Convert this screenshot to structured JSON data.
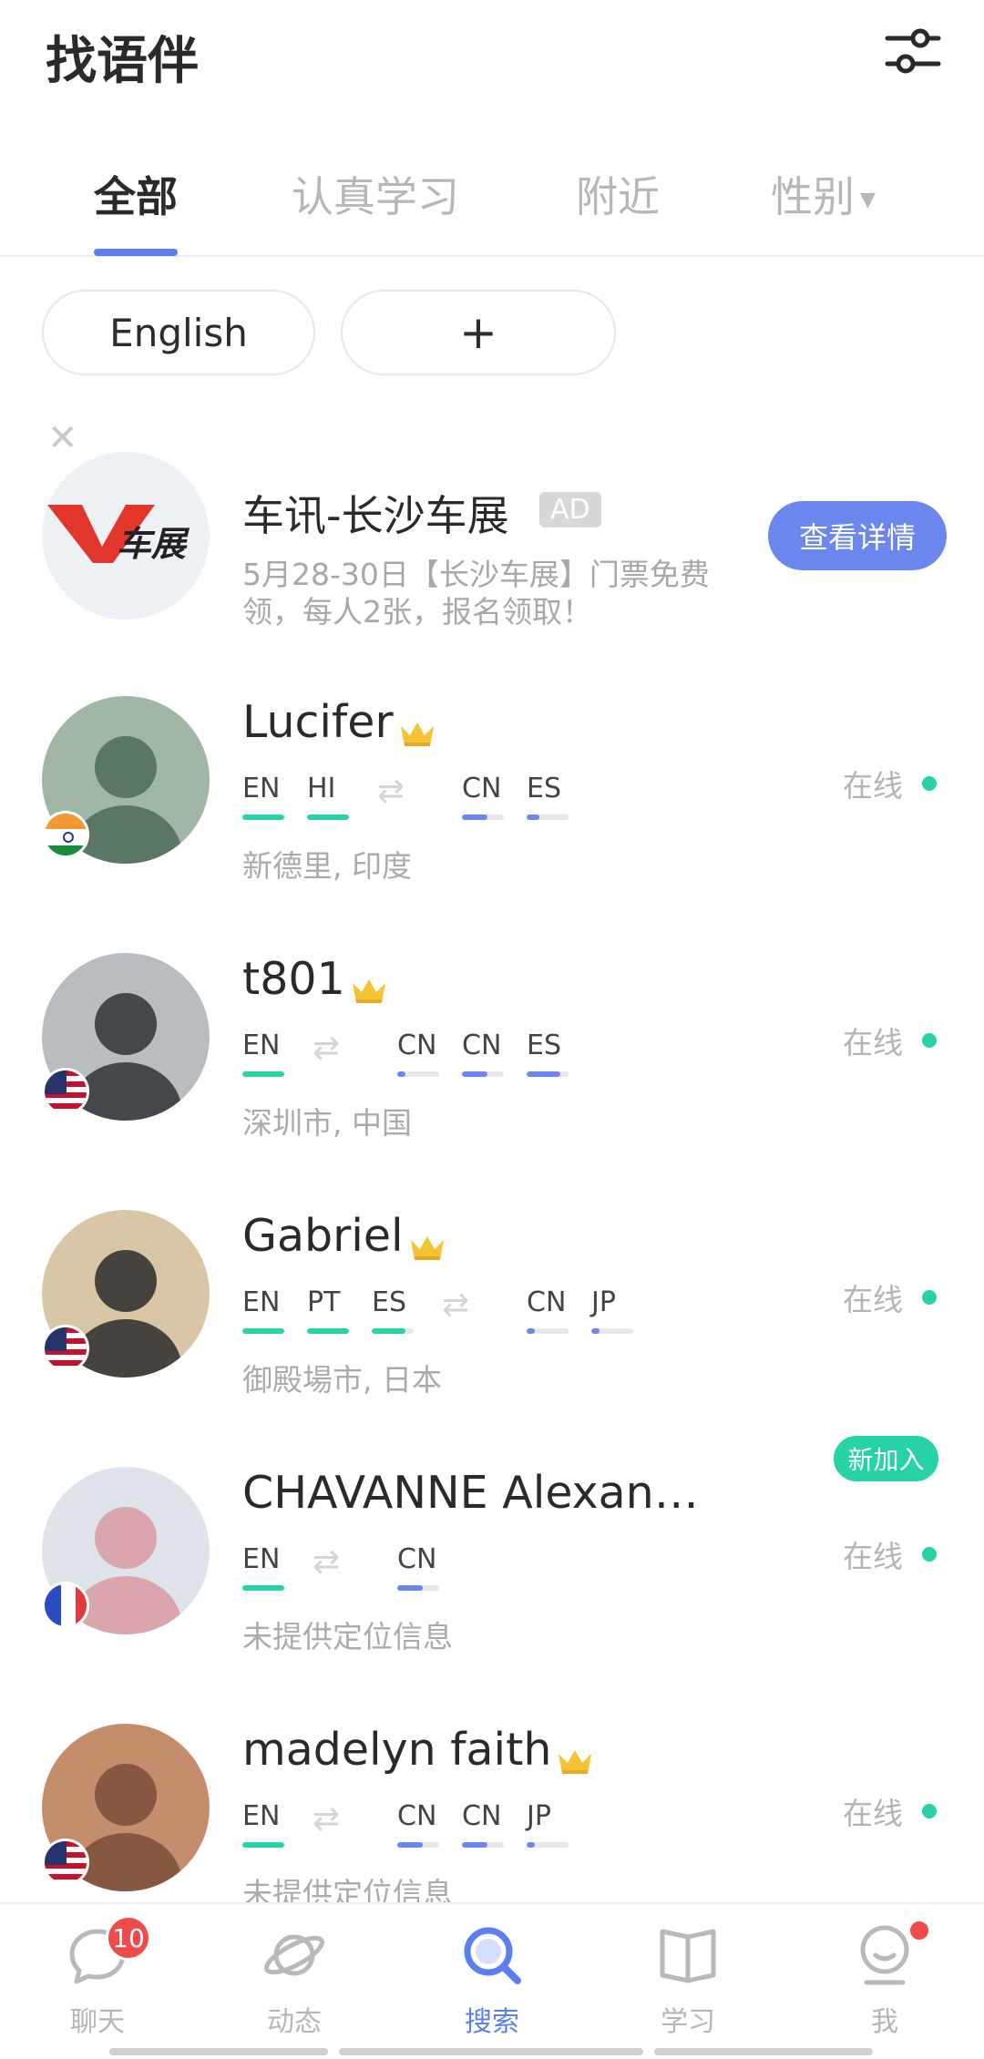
{
  "header": {
    "title": "找语伴"
  },
  "tabs": [
    {
      "label": "全部"
    },
    {
      "label": "认真学习"
    },
    {
      "label": "附近"
    },
    {
      "label": "性别"
    }
  ],
  "chips": {
    "language": "English",
    "add": "+"
  },
  "ad": {
    "name": "车讯-长沙车展",
    "tag": "AD",
    "logo_text": "车展",
    "desc_line1": "5月28-30日【长沙车展】门票免费",
    "desc_line2": "领，每人2张，报名领取！",
    "button": "查看详情"
  },
  "users": [
    {
      "name": "Lucifer",
      "crown": true,
      "flag": "india",
      "native": [
        "EN",
        "HI"
      ],
      "learning": [
        "CN",
        "ES"
      ],
      "native_levels": [
        1,
        1
      ],
      "learning_levels": [
        0.6,
        0.3
      ],
      "location": "新德里, 印度",
      "status": "在线"
    },
    {
      "name": "t801",
      "crown": true,
      "flag": "usa",
      "native": [
        "EN"
      ],
      "learning": [
        "CN",
        "CN",
        "ES"
      ],
      "native_levels": [
        1
      ],
      "learning_levels": [
        0.2,
        0.6,
        0.8
      ],
      "location": "深圳市, 中国",
      "status": "在线"
    },
    {
      "name": "Gabriel",
      "crown": true,
      "flag": "usa",
      "native": [
        "EN",
        "PT",
        "ES"
      ],
      "learning": [
        "CN",
        "JP"
      ],
      "native_levels": [
        1,
        1,
        0.8
      ],
      "learning_levels": [
        0.2,
        0.2
      ],
      "location": "御殿場市, 日本",
      "status": "在线"
    },
    {
      "name": "CHAVANNE Alexan…",
      "crown": false,
      "flag": "france",
      "badge": "新加入",
      "native": [
        "EN"
      ],
      "learning": [
        "CN"
      ],
      "native_levels": [
        1
      ],
      "learning_levels": [
        0.6
      ],
      "location": "未提供定位信息",
      "status": "在线"
    },
    {
      "name": "madelyn faith",
      "crown": true,
      "flag": "usa",
      "native": [
        "EN"
      ],
      "learning": [
        "CN",
        "CN",
        "JP"
      ],
      "native_levels": [
        1
      ],
      "learning_levels": [
        0.6,
        0.6,
        0.2
      ],
      "location": "未提供定位信息",
      "status": "在线"
    }
  ],
  "bottom_nav": [
    {
      "label": "聊天",
      "icon": "chat-icon",
      "badge": "10"
    },
    {
      "label": "动态",
      "icon": "planet-icon"
    },
    {
      "label": "搜索",
      "icon": "search-icon",
      "active": true
    },
    {
      "label": "学习",
      "icon": "book-icon"
    },
    {
      "label": "我",
      "icon": "profile-icon",
      "dot": true
    }
  ],
  "colors": {
    "accent": "#5b7ef0",
    "native_bar": "#27d3a6",
    "learn_bar": "#6b86ee",
    "online": "#27d3a6",
    "badge": "#f04a4a"
  }
}
